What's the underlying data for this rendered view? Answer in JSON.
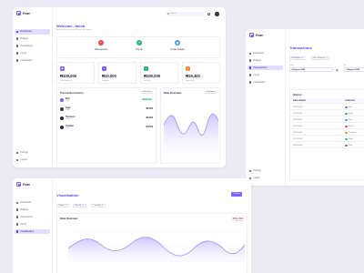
{
  "colors": {
    "accent": "#7b61ff",
    "accent_light": "#e3ddff",
    "bg": "#ecebf5",
    "red": "#ef4949",
    "green": "#1faa5a",
    "orange": "#ff8a3d"
  },
  "brand": "Fewe",
  "nav_items": [
    "Dashboard",
    "Budgets",
    "Transactions",
    "Cards",
    "Visualisation"
  ],
  "nav_bottom": [
    "Settings",
    "Logout"
  ],
  "dashboard": {
    "welcome": "Welcome, Jacob",
    "subtitle": "Review your account & financial activity",
    "search_placeholder": "Search",
    "quick_actions": [
      {
        "label": "Add expense",
        "icon": "minus-icon",
        "symbol": "−",
        "color": "#ef4949"
      },
      {
        "label": "Top Up",
        "icon": "plus-icon",
        "symbol": "+",
        "color": "#2cb67d"
      },
      {
        "label": "Create budget",
        "icon": "wallet-icon",
        "symbol": "▣",
        "color": "#3aa0e8"
      }
    ],
    "stats": [
      {
        "value": "₦100,000",
        "label": "Total Balance",
        "color": "#7b61ff"
      },
      {
        "value": "₦10,000",
        "label": "Budgets",
        "color": "#7b61ff"
      },
      {
        "value": "₦100,000",
        "label": "Income",
        "color": "#2cb67d"
      },
      {
        "value": "₦19,400",
        "label": "Expenses",
        "color": "#ff8a3d"
      }
    ],
    "transaction_history": {
      "title": "Transaction history",
      "filter": "This wk",
      "rows": [
        {
          "name": "Nick",
          "date": "23 Apr",
          "amount": "+₦100,000",
          "type": "credit",
          "color": "#7b61ff"
        },
        {
          "name": "Vega",
          "date": "23 Apr",
          "amount": "₦5,000",
          "type": "debit",
          "color": "#3a3550"
        },
        {
          "name": "Transport",
          "date": "22 Apr",
          "amount": "₦3,000",
          "type": "debit",
          "color": "#2b2740"
        },
        {
          "name": "Youtube",
          "date": "22 Apr",
          "amount": "₦4,500",
          "type": "debit",
          "color": "#2b2740"
        }
      ]
    },
    "data_overview": {
      "title": "Data Overview",
      "filter": "Weekly"
    }
  },
  "transactions": {
    "title": "Transactions",
    "filters": [
      "All Budgets",
      "All Categories"
    ],
    "date_labels": [
      "From",
      "To"
    ],
    "dates": [
      "9 August 2023",
      "9 August 2023"
    ],
    "history_title": "History",
    "columns": [
      "DATE UPDATE",
      "CATEGORY"
    ],
    "rows": [
      {
        "date": "2023-05-09",
        "category": "Data",
        "color": "#7b61ff"
      },
      {
        "date": "2023-05-09",
        "category": "Food",
        "color": "#2cb67d"
      },
      {
        "date": "2023-05-09",
        "category": "Rent",
        "color": "#3aa0e8"
      },
      {
        "date": "2023-05-09",
        "category": "Social",
        "color": "#ef4949"
      },
      {
        "date": "2023-05-09",
        "category": "Transport",
        "color": "#ff8a3d"
      },
      {
        "date": "2023-05-09",
        "category": "Food",
        "color": "#2cb67d"
      },
      {
        "date": "2023-05-09",
        "category": "Data",
        "color": "#7b61ff"
      }
    ]
  },
  "visualisation": {
    "title": "Visualisation",
    "export_label": "Export",
    "filters": [
      "Budget",
      "Monthly",
      "Category"
    ],
    "chart_title": "Data Overview",
    "chart_value": "₦19,400",
    "chart_value_label": "Expenses"
  }
}
